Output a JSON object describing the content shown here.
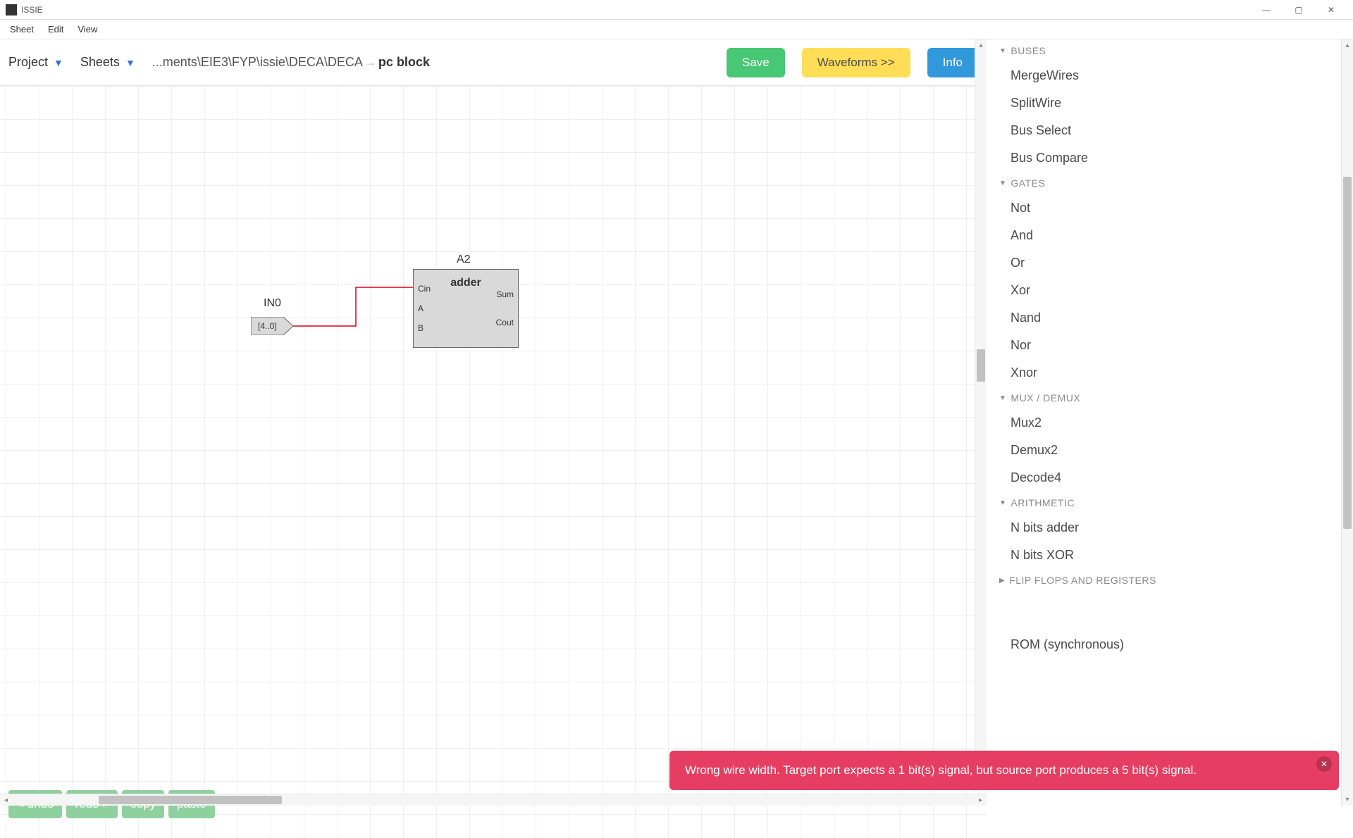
{
  "titlebar": {
    "title": "ISSIE"
  },
  "menubar": {
    "items": [
      "Sheet",
      "Edit",
      "View"
    ]
  },
  "toolbar": {
    "project_label": "Project",
    "sheets_label": "Sheets",
    "breadcrumb_prefix": "...ments\\EIE3\\FYP\\issie\\DECA\\DECA",
    "breadcrumb_arrow": "→",
    "breadcrumb_current": "pc block",
    "save_label": "Save",
    "waveforms_label": "Waveforms >>",
    "info_label": "Info"
  },
  "canvas": {
    "input_comp": {
      "name": "IN0",
      "bus_label": "[4..0]"
    },
    "adder_comp": {
      "instance": "A2",
      "title": "adder",
      "ports_left": [
        "Cin",
        "A",
        "B"
      ],
      "ports_right": [
        "Sum",
        "Cout"
      ]
    }
  },
  "float_buttons": {
    "undo": "< undo",
    "redo": "redo >",
    "copy": "copy",
    "paste": "paste"
  },
  "error": {
    "message": "Wrong wire width. Target port expects a 1 bit(s) signal, but source port produces a 5 bit(s) signal."
  },
  "sidebar": {
    "categories": [
      {
        "title": "BUSES",
        "open": true,
        "items": [
          "MergeWires",
          "SplitWire",
          "Bus Select",
          "Bus Compare"
        ]
      },
      {
        "title": "GATES",
        "open": true,
        "items": [
          "Not",
          "And",
          "Or",
          "Xor",
          "Nand",
          "Nor",
          "Xnor"
        ]
      },
      {
        "title": "MUX / DEMUX",
        "open": true,
        "items": [
          "Mux2",
          "Demux2",
          "Decode4"
        ]
      },
      {
        "title": "ARITHMETIC",
        "open": true,
        "items": [
          "N bits adder",
          "N bits XOR"
        ]
      },
      {
        "title": "FLIP FLOPS AND REGISTERS",
        "open": false,
        "items": []
      }
    ],
    "tail_item": "ROM (synchronous)"
  }
}
